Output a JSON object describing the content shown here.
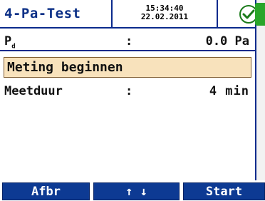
{
  "header": {
    "title": "4-Pa-Test",
    "time": "15:34:40",
    "date": "22.02.2011",
    "status_icon": "check-circle-icon",
    "battery_icon": "battery-icon"
  },
  "measure_rows": [
    {
      "label_main": "P",
      "label_sub": "d",
      "separator": ":",
      "value": "0.0 Pa"
    }
  ],
  "menu": {
    "selected_item": "Meting beginnen",
    "duration_label": "Meetduur",
    "duration_separator": ":",
    "duration_value": "4 min"
  },
  "footer": {
    "buttons": [
      {
        "label": "Afbr"
      },
      {
        "label": "↑ ↓"
      },
      {
        "label": "Start"
      }
    ]
  },
  "colors": {
    "accent_blue": "#0d3a93",
    "highlight": "#f8e2bc",
    "ok_green": "#2aa52a"
  }
}
